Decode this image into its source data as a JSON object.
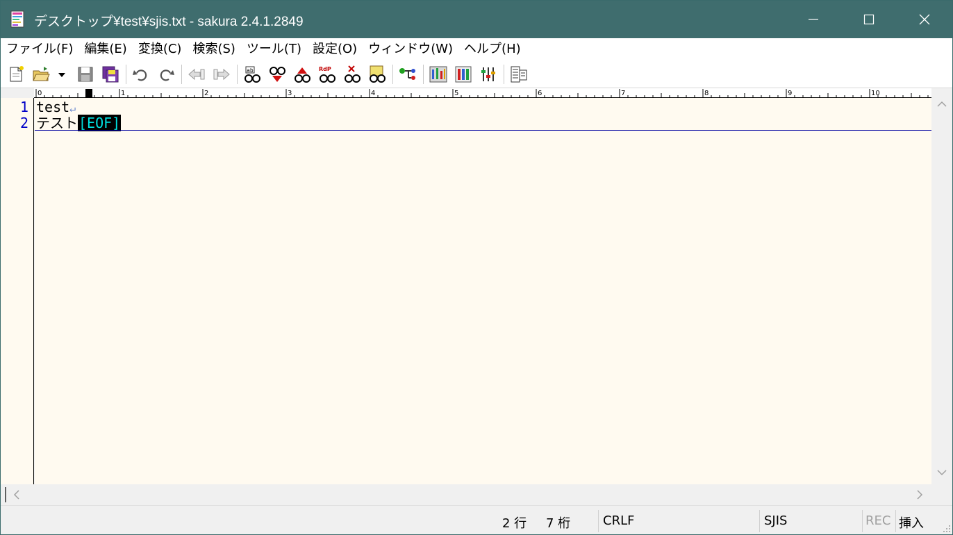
{
  "window": {
    "title": "デスクトップ¥test¥sjis.txt - sakura 2.4.1.2849",
    "controls": [
      "minimize-icon",
      "maximize-icon",
      "close-icon"
    ]
  },
  "menu": {
    "items": [
      "ファイル(F)",
      "編集(E)",
      "変換(C)",
      "検索(S)",
      "ツール(T)",
      "設定(O)",
      "ウィンドウ(W)",
      "ヘルプ(H)"
    ]
  },
  "toolbar": {
    "icons": [
      "new-file-icon",
      "open-file-icon",
      "dropdown-arrow-icon",
      "save-icon",
      "save-all-icon",
      "undo-icon",
      "redo-icon",
      "jump-back-icon",
      "jump-forward-icon",
      "search-icon",
      "search-next-icon",
      "search-prev-icon",
      "replace-icon",
      "clear-mark-icon",
      "grep-icon",
      "outline-icon",
      "common-settings-icon",
      "type-settings-icon",
      "font-settings-icon",
      "function-list-icon"
    ]
  },
  "ruler": {
    "labels": [
      "0",
      "1",
      "2",
      "3",
      "4",
      "5",
      "6",
      "7",
      "8",
      "9",
      "10"
    ]
  },
  "editor": {
    "lines": [
      {
        "number": "1",
        "text": "test",
        "eol": "↵"
      },
      {
        "number": "2",
        "text": "テスト",
        "eof": "[EOF]"
      }
    ]
  },
  "status": {
    "row": "2 行",
    "col": "7 桁",
    "line_ending": "CRLF",
    "encoding": "SJIS",
    "rec": "REC",
    "mode": "挿入"
  },
  "colors": {
    "titlebar": "#3f6d6e",
    "editor_bg": "#fffaf0",
    "line_number": "#0000c8",
    "eof_fg": "#00e0e0"
  }
}
